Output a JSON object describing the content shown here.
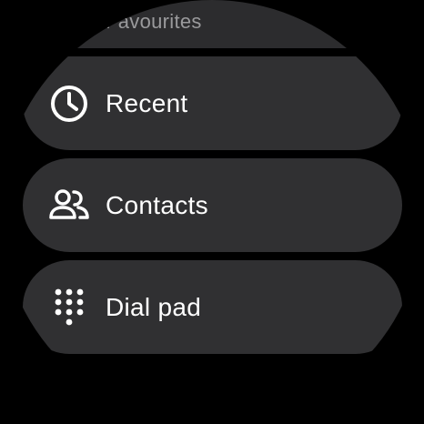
{
  "menu": {
    "items": [
      {
        "label": "Favourites",
        "icon": "star-icon"
      },
      {
        "label": "Recent",
        "icon": "clock-icon"
      },
      {
        "label": "Contacts",
        "icon": "people-icon"
      },
      {
        "label": "Dial pad",
        "icon": "dialpad-icon"
      }
    ]
  },
  "colors": {
    "background": "#000000",
    "chip": "#303032",
    "text": "#ffffff",
    "muted_text": "#9a9a9c"
  }
}
